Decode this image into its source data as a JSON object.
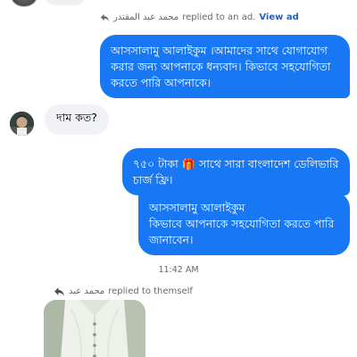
{
  "top_reply": {
    "sender": "محمد عبد المقتدر",
    "action": "replied to an ad.",
    "link": "View ad"
  },
  "messages": {
    "outgoing_1": "আসসালামু আলাইকুম ।আমাদের সাথে যোগাযোগ করার জন্য আপনাকে ধন্যবাদ। কিভাবে সহযোগিতা করতে পারি আপনাকে।",
    "incoming_1": "দাম কত?",
    "outgoing_2": "৭৫০ টাকা 🎁 সাথে সারা বাংলাদেশ ডেলিভারি চার্জ ফ্রি।",
    "outgoing_3": "আসসালামু আলাইকুম\nকিভাবে আপনাকে সহযোগিতা করতে পারি জানাবেন।"
  },
  "timestamp": "11:42 AM",
  "self_reply": {
    "sender": "محمد عبد",
    "action": "replied to themself"
  },
  "colors": {
    "outgoing_bubble": "#1877f2",
    "incoming_bubble": "#f0f2f5",
    "link": "#1a62d6",
    "meta_text": "#65676b"
  },
  "icons": {
    "reply": "reply-arrow-icon",
    "gift": "gift-icon"
  }
}
